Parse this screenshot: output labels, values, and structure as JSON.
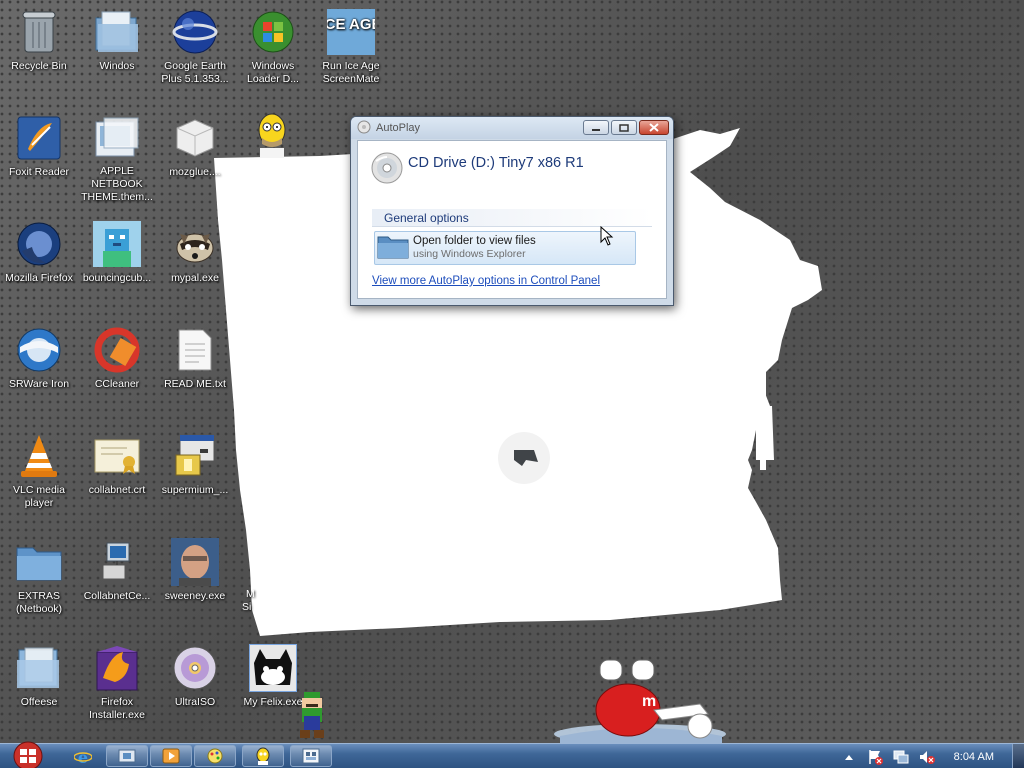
{
  "desktop": {
    "icons": [
      {
        "label": "Recycle Bin",
        "icon": "recycle-bin-icon"
      },
      {
        "label": "Windos",
        "icon": "folder-windows-icon"
      },
      {
        "label": "Google Earth Plus 5.1.353...",
        "icon": "google-earth-icon"
      },
      {
        "label": "Windows Loader D...",
        "icon": "windows-loader-icon"
      },
      {
        "label": "Run Ice Age ScreenMate",
        "icon": "ice-age-icon",
        "icon_text": "ICE AGE"
      },
      {
        "label": "Foxit Reader",
        "icon": "foxit-reader-icon"
      },
      {
        "label": "APPLE NETBOOK THEME.them...",
        "icon": "theme-file-icon"
      },
      {
        "label": "mozglue....",
        "icon": "dll-file-icon"
      },
      {
        "label": "Mozilla Firefox",
        "icon": "firefox-icon"
      },
      {
        "label": "bouncingcub...",
        "icon": "bouncing-cube-icon"
      },
      {
        "label": "mypal.exe",
        "icon": "raccoon-icon"
      },
      {
        "label": "SRWare Iron",
        "icon": "srware-iron-icon"
      },
      {
        "label": "CCleaner",
        "icon": "ccleaner-icon"
      },
      {
        "label": "READ ME.txt",
        "icon": "text-file-icon"
      },
      {
        "label": "VLC media player",
        "icon": "vlc-icon"
      },
      {
        "label": "collabnet.crt",
        "icon": "certificate-icon"
      },
      {
        "label": "supermium_...",
        "icon": "installer-icon"
      },
      {
        "label": "EXTRAS (Netbook)",
        "icon": "folder-icon"
      },
      {
        "label": "CollabnetCe...",
        "icon": "network-computer-icon"
      },
      {
        "label": "sweeney.exe",
        "icon": "photo-face-icon"
      },
      {
        "label": "Offeese",
        "icon": "folder-docs-icon"
      },
      {
        "label": "Firefox Installer.exe",
        "icon": "firefox-installer-icon"
      },
      {
        "label": "UltraISO",
        "icon": "ultraiso-disc-icon"
      },
      {
        "label": "My Felix.exe",
        "icon": "cat-icon"
      }
    ],
    "partial_labels": [
      "M",
      "Si"
    ]
  },
  "autoplay": {
    "window_title": "AutoPlay",
    "drive_title": "CD Drive (D:) Tiny7 x86 R1",
    "section_header": "General options",
    "option_main": "Open folder to view files",
    "option_sub": "using Windows Explorer",
    "control_panel_link": "View more AutoPlay options in Control Panel",
    "buttons": {
      "minimize": "minimize",
      "maximize": "maximize",
      "close": "close"
    }
  },
  "taskbar": {
    "start": "start-orb-icon",
    "quick_launch": [
      "internet-explorer-icon"
    ],
    "tasks": [
      "explorer-window-icon",
      "media-player-icon",
      "paint-icon",
      "homer-icon",
      "autoplay-task-icon"
    ],
    "tray_icons": [
      "show-hidden-arrow-icon",
      "action-center-icon",
      "network-icon",
      "volume-muted-icon"
    ],
    "clock": "8:04 AM"
  },
  "colors": {
    "link": "#1d4dbc",
    "dialog_title": "#1e3b7a",
    "taskbar": "#3f6798"
  }
}
